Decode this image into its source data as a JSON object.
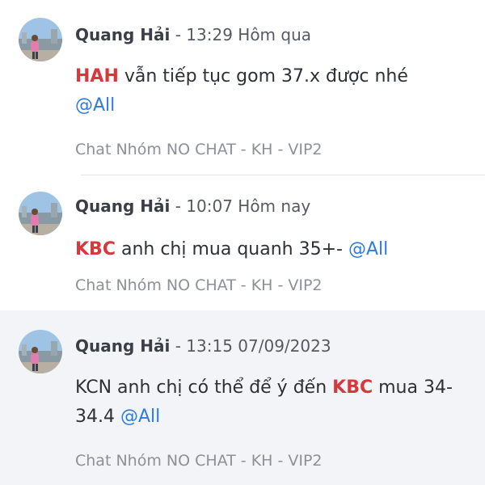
{
  "messages": [
    {
      "author": "Quang Hải",
      "sep": " - ",
      "time": "13:29 Hôm qua",
      "body": {
        "ticker": "HAH",
        "text_after_ticker": " vẫn tiếp tục gom 37.x được nhé ",
        "mention": "@All"
      },
      "source": "Chat Nhóm NO CHAT - KH - VIP2"
    },
    {
      "author": "Quang Hải",
      "sep": " - ",
      "time": "10:07 Hôm nay",
      "body": {
        "ticker": "KBC",
        "text_after_ticker": " anh chị mua quanh 35+- ",
        "mention": "@All"
      },
      "source": "Chat Nhóm NO CHAT - KH - VIP2"
    },
    {
      "author": "Quang Hải",
      "sep": " - ",
      "time": "13:15 07/09/2023",
      "body": {
        "text_before_ticker": "KCN anh chị có thể để ý đến ",
        "ticker": "KBC",
        "text_after_ticker": " mua 34-34.4 ",
        "mention": "@All"
      },
      "source": "Chat Nhóm NO CHAT - KH - VIP2"
    }
  ],
  "colors": {
    "ticker": "#d8373c",
    "mention": "#2d7be0",
    "selected_background": "#f3f4f7"
  },
  "icons": {
    "avatar": "user-photo-avatar"
  }
}
